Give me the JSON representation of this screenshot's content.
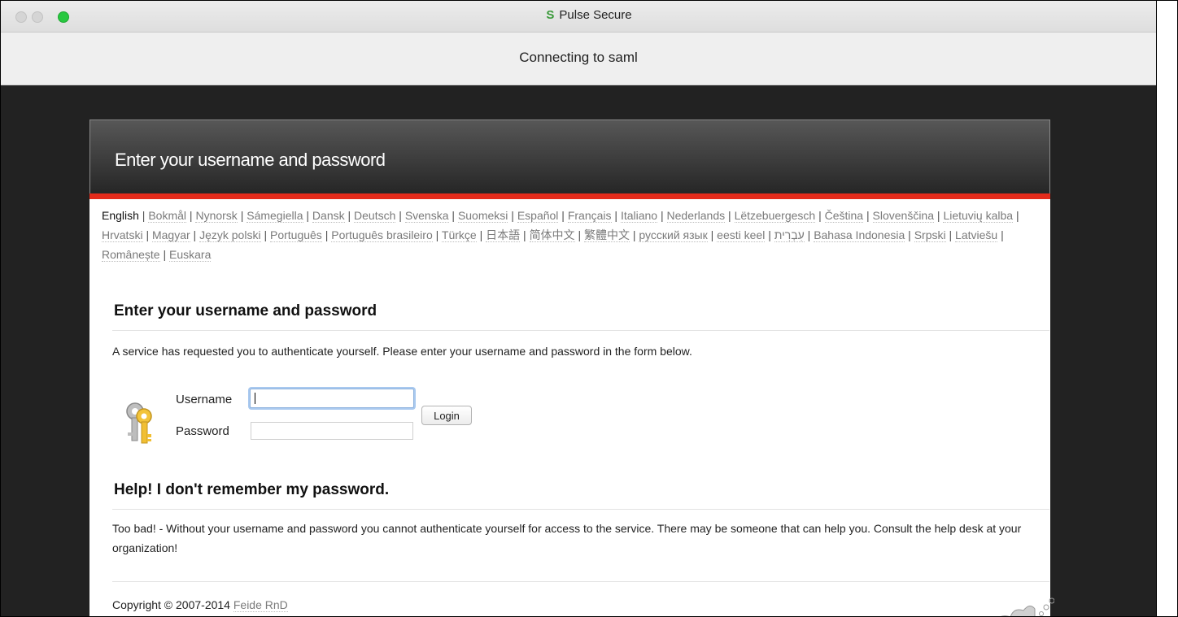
{
  "window": {
    "app_title": "Pulse Secure",
    "subtitle": "Connecting to saml"
  },
  "header": {
    "title": "Enter your username and password"
  },
  "languages": {
    "current": "English",
    "items": [
      "Bokmål",
      "Nynorsk",
      "Sámegiella",
      "Dansk",
      "Deutsch",
      "Svenska",
      "Suomeksi",
      "Español",
      "Français",
      "Italiano",
      "Nederlands",
      "Lëtzebuergesch",
      "Čeština",
      "Slovenščina",
      "Lietuvių kalba",
      "Hrvatski",
      "Magyar",
      "Język polski",
      "Português",
      "Português brasileiro",
      "Türkçe",
      "日本語",
      "简体中文",
      "繁體中文",
      "русский язык",
      "eesti keel",
      "עִבְרִית",
      "Bahasa Indonesia",
      "Srpski",
      "Latviešu",
      "Românește",
      "Euskara"
    ]
  },
  "login": {
    "heading": "Enter your username and password",
    "description": "A service has requested you to authenticate yourself. Please enter your username and password in the form below.",
    "username_label": "Username",
    "password_label": "Password",
    "username_value": "",
    "password_value": "",
    "login_button": "Login"
  },
  "help": {
    "heading": "Help! I don't remember my password.",
    "text": "Too bad! - Without your username and password you cannot authenticate yourself for access to the service. There may be someone that can help you. Consult the help desk at your organization!"
  },
  "footer": {
    "copyright": "Copyright © 2007-2014",
    "link": "Feide RnD"
  },
  "colors": {
    "accent_red": "#e42b1b",
    "traffic_green": "#28c840"
  }
}
